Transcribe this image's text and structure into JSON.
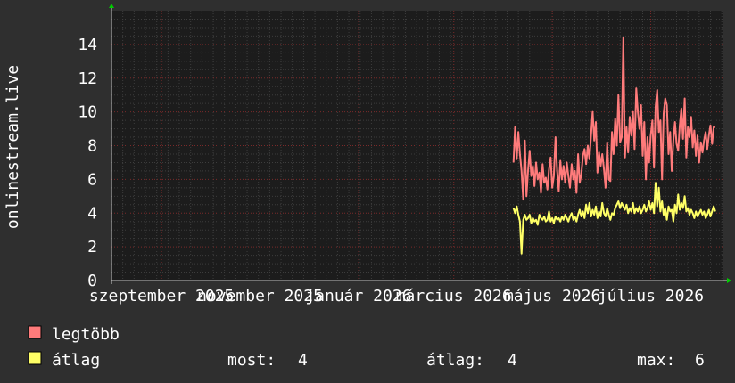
{
  "colors": {
    "background": "#2f2f2f",
    "plot_background": "#1c1c1c",
    "grid": "#3d3d3d",
    "major_grid": "#7a2a2a",
    "axis": "#cccccc",
    "text": "#ffffff",
    "legtobb": "#ff7b7b",
    "atlag": "#ffff66",
    "arrow": "#00cc00"
  },
  "chart_data": {
    "type": "line",
    "ylabel": "onlinestream.live",
    "ylim": [
      0,
      16
    ],
    "yticks": [
      0,
      2,
      4,
      6,
      8,
      10,
      12,
      14
    ],
    "xticks": [
      {
        "label": "szeptember 2025",
        "date": "2025-09-01"
      },
      {
        "label": "november 2025",
        "date": "2025-11-01"
      },
      {
        "label": "január 2026",
        "date": "2026-01-01"
      },
      {
        "label": "március 2026",
        "date": "2026-03-01"
      },
      {
        "label": "május 2026",
        "date": "2026-05-01"
      },
      {
        "label": "július 2026",
        "date": "2026-07-01"
      }
    ],
    "xlim": [
      "2025-08-01",
      "2026-08-15"
    ],
    "grid": true,
    "series": [
      {
        "name": "legtöbb",
        "color": "#ff7b7b",
        "points": [
          [
            "2026-04-07",
            7
          ],
          [
            "2026-04-08",
            9.1
          ],
          [
            "2026-04-09",
            7.2
          ],
          [
            "2026-04-10",
            8.8
          ],
          [
            "2026-04-11",
            7.5
          ],
          [
            "2026-04-12",
            6.5
          ],
          [
            "2026-04-13",
            4.8
          ],
          [
            "2026-04-14",
            8.3
          ],
          [
            "2026-04-15",
            5
          ],
          [
            "2026-04-16",
            6.5
          ],
          [
            "2026-04-17",
            7.7
          ],
          [
            "2026-04-18",
            6.2
          ],
          [
            "2026-04-19",
            6.8
          ],
          [
            "2026-04-20",
            5.6
          ],
          [
            "2026-04-21",
            7
          ],
          [
            "2026-04-22",
            6
          ],
          [
            "2026-04-23",
            6.4
          ],
          [
            "2026-04-24",
            5.2
          ],
          [
            "2026-04-25",
            6.9
          ],
          [
            "2026-04-26",
            5.8
          ],
          [
            "2026-04-27",
            6.1
          ],
          [
            "2026-04-28",
            5.4
          ],
          [
            "2026-04-29",
            6.6
          ],
          [
            "2026-04-30",
            7.3
          ],
          [
            "2026-05-01",
            5.5
          ],
          [
            "2026-05-02",
            6.2
          ],
          [
            "2026-05-03",
            8.5
          ],
          [
            "2026-05-04",
            6.5
          ],
          [
            "2026-05-05",
            5.3
          ],
          [
            "2026-05-06",
            7.1
          ],
          [
            "2026-05-07",
            6
          ],
          [
            "2026-05-08",
            6.8
          ],
          [
            "2026-05-09",
            5.8
          ],
          [
            "2026-05-10",
            7
          ],
          [
            "2026-05-11",
            6.2
          ],
          [
            "2026-05-12",
            5.5
          ],
          [
            "2026-05-13",
            6.9
          ],
          [
            "2026-05-14",
            6
          ],
          [
            "2026-05-15",
            6.5
          ],
          [
            "2026-05-16",
            5.2
          ],
          [
            "2026-05-17",
            7.5
          ],
          [
            "2026-05-18",
            5.8
          ],
          [
            "2026-05-19",
            6.3
          ],
          [
            "2026-05-20",
            7.4
          ],
          [
            "2026-05-21",
            7.8
          ],
          [
            "2026-05-22",
            6.9
          ],
          [
            "2026-05-23",
            8
          ],
          [
            "2026-05-24",
            7.2
          ],
          [
            "2026-05-25",
            8.6
          ],
          [
            "2026-05-26",
            10
          ],
          [
            "2026-05-27",
            8.3
          ],
          [
            "2026-05-28",
            9.4
          ],
          [
            "2026-05-29",
            6.4
          ],
          [
            "2026-05-30",
            7.6
          ],
          [
            "2026-05-31",
            6.8
          ],
          [
            "2026-06-01",
            7.5
          ],
          [
            "2026-06-02",
            6.6
          ],
          [
            "2026-06-03",
            5.5
          ],
          [
            "2026-06-04",
            8.2
          ],
          [
            "2026-06-05",
            6
          ],
          [
            "2026-06-06",
            5.9
          ],
          [
            "2026-06-07",
            8.8
          ],
          [
            "2026-06-08",
            7.5
          ],
          [
            "2026-06-09",
            9.6
          ],
          [
            "2026-06-10",
            8
          ],
          [
            "2026-06-11",
            11
          ],
          [
            "2026-06-12",
            8.2
          ],
          [
            "2026-06-13",
            8.5
          ],
          [
            "2026-06-14",
            14.4
          ],
          [
            "2026-06-15",
            7.3
          ],
          [
            "2026-06-16",
            9.1
          ],
          [
            "2026-06-17",
            7.6
          ],
          [
            "2026-06-18",
            9.7
          ],
          [
            "2026-06-19",
            8.6
          ],
          [
            "2026-06-20",
            10
          ],
          [
            "2026-06-21",
            7.8
          ],
          [
            "2026-06-22",
            11.4
          ],
          [
            "2026-06-23",
            10
          ],
          [
            "2026-06-24",
            9
          ],
          [
            "2026-06-25",
            10.4
          ],
          [
            "2026-06-26",
            7.4
          ],
          [
            "2026-06-27",
            9.4
          ],
          [
            "2026-06-28",
            6
          ],
          [
            "2026-06-29",
            8.5
          ],
          [
            "2026-06-30",
            7
          ],
          [
            "2026-07-01",
            8.6
          ],
          [
            "2026-07-02",
            9.5
          ],
          [
            "2026-07-03",
            6.7
          ],
          [
            "2026-07-04",
            10.3
          ],
          [
            "2026-07-05",
            11.3
          ],
          [
            "2026-07-06",
            8.8
          ],
          [
            "2026-07-07",
            9.5
          ],
          [
            "2026-07-08",
            6
          ],
          [
            "2026-07-09",
            9.9
          ],
          [
            "2026-07-10",
            10.8
          ],
          [
            "2026-07-11",
            10.4
          ],
          [
            "2026-07-12",
            7.5
          ],
          [
            "2026-07-13",
            8.8
          ],
          [
            "2026-07-14",
            6.5
          ],
          [
            "2026-07-15",
            8.3
          ],
          [
            "2026-07-16",
            9.4
          ],
          [
            "2026-07-17",
            8.1
          ],
          [
            "2026-07-18",
            7.7
          ],
          [
            "2026-07-19",
            9.2
          ],
          [
            "2026-07-20",
            10.2
          ],
          [
            "2026-07-21",
            8.4
          ],
          [
            "2026-07-22",
            10.8
          ],
          [
            "2026-07-23",
            7.3
          ],
          [
            "2026-07-24",
            9.1
          ],
          [
            "2026-07-25",
            8.5
          ],
          [
            "2026-07-26",
            9.7
          ],
          [
            "2026-07-27",
            7.9
          ],
          [
            "2026-07-28",
            8.9
          ],
          [
            "2026-07-29",
            7.4
          ],
          [
            "2026-07-30",
            8.6
          ],
          [
            "2026-07-31",
            7
          ],
          [
            "2026-08-01",
            8.2
          ],
          [
            "2026-08-02",
            7.6
          ],
          [
            "2026-08-03",
            8.3
          ],
          [
            "2026-08-04",
            8.8
          ],
          [
            "2026-08-05",
            7.8
          ],
          [
            "2026-08-06",
            8.6
          ],
          [
            "2026-08-07",
            9.2
          ],
          [
            "2026-08-08",
            8.1
          ],
          [
            "2026-08-09",
            9.1
          ],
          [
            "2026-08-10",
            9.1
          ]
        ]
      },
      {
        "name": "átlag",
        "color": "#ffff66",
        "points": [
          [
            "2026-04-07",
            4.3
          ],
          [
            "2026-04-08",
            4
          ],
          [
            "2026-04-09",
            4.4
          ],
          [
            "2026-04-10",
            3.9
          ],
          [
            "2026-04-11",
            3.5
          ],
          [
            "2026-04-12",
            1.6
          ],
          [
            "2026-04-13",
            3.6
          ],
          [
            "2026-04-14",
            3.9
          ],
          [
            "2026-04-15",
            3.6
          ],
          [
            "2026-04-16",
            3.7
          ],
          [
            "2026-04-17",
            3.9
          ],
          [
            "2026-04-18",
            3.4
          ],
          [
            "2026-04-19",
            3.7
          ],
          [
            "2026-04-20",
            3.5
          ],
          [
            "2026-04-21",
            3.6
          ],
          [
            "2026-04-22",
            3.3
          ],
          [
            "2026-04-23",
            3.9
          ],
          [
            "2026-04-24",
            3.7
          ],
          [
            "2026-04-25",
            3.6
          ],
          [
            "2026-04-26",
            3.8
          ],
          [
            "2026-04-27",
            3.5
          ],
          [
            "2026-04-28",
            3.6
          ],
          [
            "2026-04-29",
            4.1
          ],
          [
            "2026-04-30",
            3.5
          ],
          [
            "2026-05-01",
            3.7
          ],
          [
            "2026-05-02",
            3.4
          ],
          [
            "2026-05-03",
            3.8
          ],
          [
            "2026-05-04",
            3.6
          ],
          [
            "2026-05-05",
            3.7
          ],
          [
            "2026-05-06",
            3.5
          ],
          [
            "2026-05-07",
            3.8
          ],
          [
            "2026-05-08",
            3.6
          ],
          [
            "2026-05-09",
            3.9
          ],
          [
            "2026-05-10",
            3.7
          ],
          [
            "2026-05-11",
            3.5
          ],
          [
            "2026-05-12",
            3.8
          ],
          [
            "2026-05-13",
            4
          ],
          [
            "2026-05-14",
            3.6
          ],
          [
            "2026-05-15",
            3.8
          ],
          [
            "2026-05-16",
            3.5
          ],
          [
            "2026-05-17",
            3.9
          ],
          [
            "2026-05-18",
            4.2
          ],
          [
            "2026-05-19",
            3.8
          ],
          [
            "2026-05-20",
            4.1
          ],
          [
            "2026-05-21",
            3.7
          ],
          [
            "2026-05-22",
            4.5
          ],
          [
            "2026-05-23",
            4
          ],
          [
            "2026-05-24",
            4.6
          ],
          [
            "2026-05-25",
            3.8
          ],
          [
            "2026-05-26",
            4.2
          ],
          [
            "2026-05-27",
            3.9
          ],
          [
            "2026-05-28",
            4.4
          ],
          [
            "2026-05-29",
            3.7
          ],
          [
            "2026-05-30",
            4.1
          ],
          [
            "2026-05-31",
            3.8
          ],
          [
            "2026-06-01",
            4.6
          ],
          [
            "2026-06-02",
            4
          ],
          [
            "2026-06-03",
            3.8
          ],
          [
            "2026-06-04",
            4.3
          ],
          [
            "2026-06-05",
            3.9
          ],
          [
            "2026-06-06",
            3.6
          ],
          [
            "2026-06-07",
            4
          ],
          [
            "2026-06-08",
            3.9
          ],
          [
            "2026-06-09",
            4.3
          ],
          [
            "2026-06-10",
            4.5
          ],
          [
            "2026-06-11",
            4.7
          ],
          [
            "2026-06-12",
            4.3
          ],
          [
            "2026-06-13",
            4.6
          ],
          [
            "2026-06-14",
            4.4
          ],
          [
            "2026-06-15",
            4.2
          ],
          [
            "2026-06-16",
            4.5
          ],
          [
            "2026-06-17",
            4
          ],
          [
            "2026-06-18",
            4.3
          ],
          [
            "2026-06-19",
            4.1
          ],
          [
            "2026-06-20",
            4.6
          ],
          [
            "2026-06-21",
            4
          ],
          [
            "2026-06-22",
            4.3
          ],
          [
            "2026-06-23",
            4.1
          ],
          [
            "2026-06-24",
            4.4
          ],
          [
            "2026-06-25",
            4
          ],
          [
            "2026-06-26",
            4.2
          ],
          [
            "2026-06-27",
            4.5
          ],
          [
            "2026-06-28",
            4.1
          ],
          [
            "2026-06-29",
            4.3
          ],
          [
            "2026-06-30",
            4.7
          ],
          [
            "2026-07-01",
            4.2
          ],
          [
            "2026-07-02",
            4.6
          ],
          [
            "2026-07-03",
            4
          ],
          [
            "2026-07-04",
            5.8
          ],
          [
            "2026-07-05",
            4.4
          ],
          [
            "2026-07-06",
            5.5
          ],
          [
            "2026-07-07",
            4.1
          ],
          [
            "2026-07-08",
            4.7
          ],
          [
            "2026-07-09",
            3.9
          ],
          [
            "2026-07-10",
            4.3
          ],
          [
            "2026-07-11",
            3.6
          ],
          [
            "2026-07-12",
            4.4
          ],
          [
            "2026-07-13",
            4.1
          ],
          [
            "2026-07-14",
            4.2
          ],
          [
            "2026-07-15",
            3.5
          ],
          [
            "2026-07-16",
            4.5
          ],
          [
            "2026-07-17",
            4
          ],
          [
            "2026-07-18",
            5.1
          ],
          [
            "2026-07-19",
            4.2
          ],
          [
            "2026-07-20",
            4.6
          ],
          [
            "2026-07-21",
            4.3
          ],
          [
            "2026-07-22",
            5
          ],
          [
            "2026-07-23",
            4.1
          ],
          [
            "2026-07-24",
            4.3
          ],
          [
            "2026-07-25",
            3.9
          ],
          [
            "2026-07-26",
            4.2
          ],
          [
            "2026-07-27",
            4
          ],
          [
            "2026-07-28",
            3.7
          ],
          [
            "2026-07-29",
            4.1
          ],
          [
            "2026-07-30",
            3.8
          ],
          [
            "2026-07-31",
            4
          ],
          [
            "2026-08-01",
            4.2
          ],
          [
            "2026-08-02",
            3.9
          ],
          [
            "2026-08-03",
            4.1
          ],
          [
            "2026-08-04",
            3.7
          ],
          [
            "2026-08-05",
            3.9
          ],
          [
            "2026-08-06",
            4.2
          ],
          [
            "2026-08-07",
            3.8
          ],
          [
            "2026-08-08",
            4.1
          ],
          [
            "2026-08-09",
            4.4
          ],
          [
            "2026-08-10",
            4.1
          ]
        ]
      }
    ]
  },
  "legend": {
    "items": [
      {
        "label": "legtöbb",
        "color": "#ff7b7b"
      },
      {
        "label": "átlag",
        "color": "#ffff66"
      }
    ],
    "stats": [
      {
        "label": "most:",
        "value": "4"
      },
      {
        "label": "átlag:",
        "value": "4"
      },
      {
        "label": "max:",
        "value": "6"
      }
    ]
  }
}
